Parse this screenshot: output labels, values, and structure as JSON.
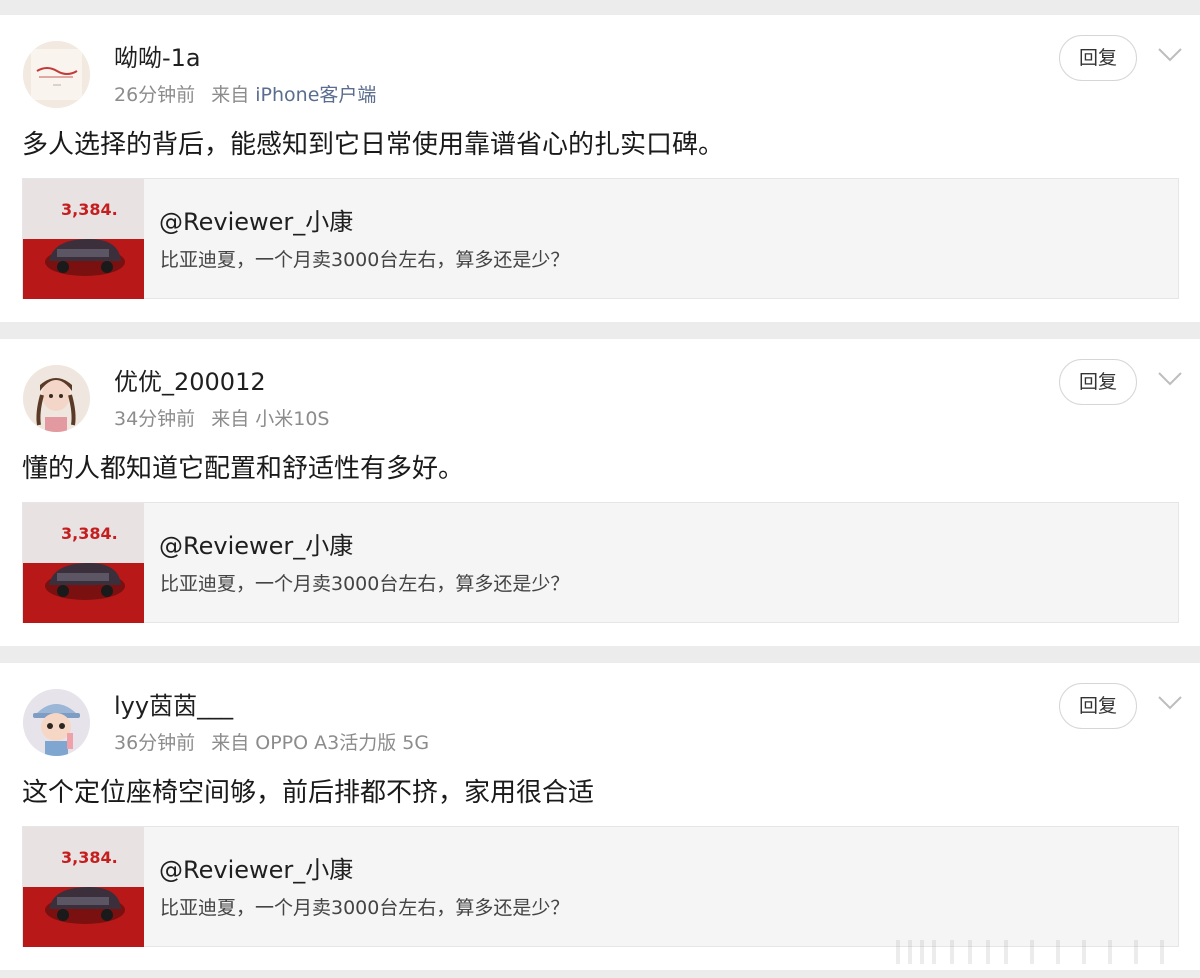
{
  "reply_label": "回复",
  "source_prefix": "来自",
  "comments": [
    {
      "username": "呦呦-1a",
      "time": "26分钟前",
      "source": "iPhone客户端",
      "text": "多人选择的背后，能感知到它日常使用靠谱省心的扎实口碑。",
      "avatar": "calligraphy-avatar",
      "embed": {
        "title": "@Reviewer_小康",
        "subtitle": "比亚迪夏，一个月卖3000台左右，算多还是少？",
        "thumb_number": "3,384."
      }
    },
    {
      "username": "优优_200012",
      "time": "34分钟前",
      "source": "小米10S",
      "text": "懂的人都知道它配置和舒适性有多好。",
      "avatar": "girl-braids-avatar",
      "embed": {
        "title": "@Reviewer_小康",
        "subtitle": "比亚迪夏，一个月卖3000台左右，算多还是少？",
        "thumb_number": "3,384."
      }
    },
    {
      "username": "lyy茵茵___",
      "time": "36分钟前",
      "source": "OPPO A3活力版 5G",
      "text": "这个定位座椅空间够，前后排都不挤，家用很合适",
      "avatar": "child-cap-avatar",
      "embed": {
        "title": "@Reviewer_小康",
        "subtitle": "比亚迪夏，一个月卖3000台左右，算多还是少？",
        "thumb_number": "3,384."
      }
    }
  ],
  "colors": {
    "page_bg": "#ececec",
    "card_bg": "#ffffff",
    "meta_gray": "#8c8c8c",
    "source_link": "#5b6d8f",
    "thumb_red": "#c41e1e"
  }
}
